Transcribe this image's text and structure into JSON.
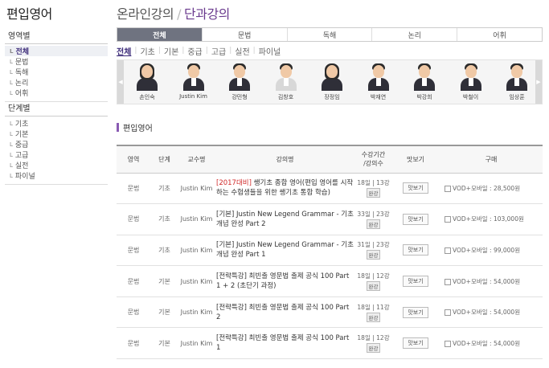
{
  "sidebar": {
    "title": "편입영어",
    "groups": [
      {
        "header": "영역별",
        "items": [
          "전체",
          "문법",
          "독해",
          "논리",
          "어휘"
        ],
        "active": 0
      },
      {
        "header": "단계별",
        "items": [
          "기초",
          "기본",
          "중급",
          "고급",
          "실전",
          "파이널"
        ]
      }
    ],
    "bullet": "L"
  },
  "header": {
    "title_main": "온라인강의",
    "separator": "/",
    "title_sub": "단과강의"
  },
  "tabs": [
    "전체",
    "문법",
    "독해",
    "논리",
    "어휘"
  ],
  "subtabs": [
    "전체",
    "기초",
    "기본",
    "중급",
    "고급",
    "실전",
    "파이널"
  ],
  "subtab_separator": "|",
  "teachers": {
    "left_arrow": "◀",
    "right_arrow": "▶",
    "items": [
      {
        "name": "손인숙",
        "style": "female"
      },
      {
        "name": "Justin Kim",
        "style": "male"
      },
      {
        "name": "강민형",
        "style": "male"
      },
      {
        "name": "김창호",
        "style": "male-light"
      },
      {
        "name": "장정임",
        "style": "female"
      },
      {
        "name": "박재연",
        "style": "male"
      },
      {
        "name": "박강희",
        "style": "male"
      },
      {
        "name": "박철이",
        "style": "male"
      },
      {
        "name": "임상훈",
        "style": "male"
      }
    ]
  },
  "section": {
    "title": "편입영어"
  },
  "table": {
    "headers": {
      "area": "영역",
      "level": "단계",
      "teacher": "교수명",
      "course": "강의명",
      "period_line1": "수강기간",
      "period_line2": "/강의수",
      "preview": "맛보기",
      "buy": "구매"
    },
    "preview_label": "맛보기",
    "badge_label": "완강",
    "rows": [
      {
        "area": "문법",
        "level": "기초",
        "teacher": "Justin Kim",
        "title_highlight": "[2017대비]",
        "title": " 쌩기초 종합 영어(편입 영어를 시작하는 수험생들을 위한 쌩기초 통합 학습)",
        "period": "18일 | 13강",
        "buy": "VOD+모바일 : 28,500원"
      },
      {
        "area": "문법",
        "level": "기초",
        "teacher": "Justin Kim",
        "title_highlight": "",
        "title": "[기본] Justin New Legend Grammar - 기초 개념 완성 Part 2",
        "period": "33일 | 23강",
        "buy": "VOD+모바일 : 103,000원"
      },
      {
        "area": "문법",
        "level": "기초",
        "teacher": "Justin Kim",
        "title_highlight": "",
        "title": "[기본] Justin New Legend Grammar - 기초 개념 완성 Part 1",
        "period": "31일 | 23강",
        "buy": "VOD+모바일 : 99,000원"
      },
      {
        "area": "문법",
        "level": "기본",
        "teacher": "Justin Kim",
        "title_highlight": "",
        "title": "[전략특강] 최빈출 영문법 출제 공식 100 Part 1 + 2 (초단기 과정)",
        "period": "18일 | 12강",
        "buy": "VOD+모바일 : 54,000원"
      },
      {
        "area": "문법",
        "level": "기본",
        "teacher": "Justin Kim",
        "title_highlight": "",
        "title": "[전략특강] 최빈출 영문법 출제 공식 100 Part 2",
        "period": "18일 | 11강",
        "buy": "VOD+모바일 : 54,000원"
      },
      {
        "area": "문법",
        "level": "기본",
        "teacher": "Justin Kim",
        "title_highlight": "",
        "title": "[전략특강] 최빈출 영문법 출제 공식 100 Part 1",
        "period": "18일 | 12강",
        "buy": "VOD+모바일 : 54,000원"
      }
    ]
  },
  "colors": {
    "accent": "#6a3a8e",
    "tab_active_bg": "#6f7380",
    "highlight": "#d12b2b"
  }
}
